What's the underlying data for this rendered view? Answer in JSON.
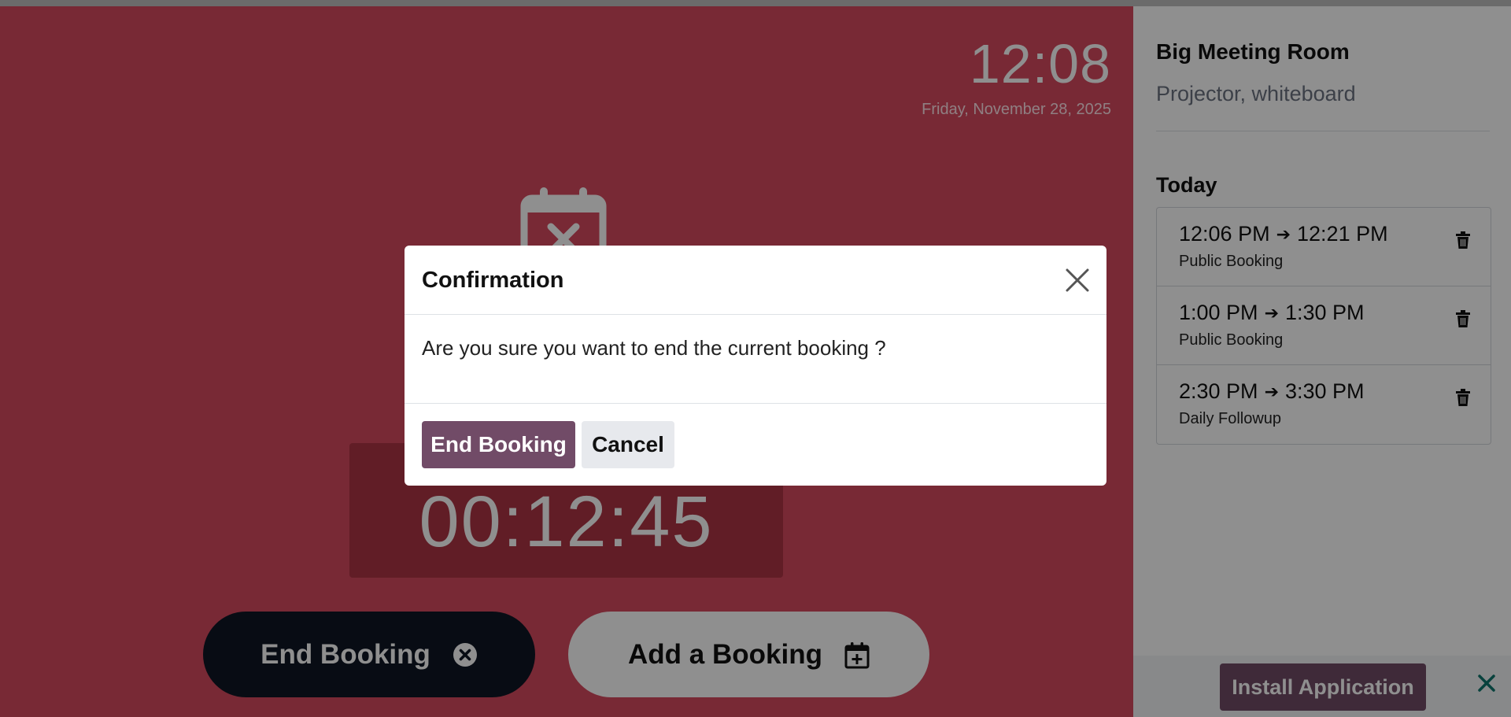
{
  "colors": {
    "main_bg": "#d6495f",
    "timer_bg": "#ad3445",
    "primary": "#714b67",
    "dark_button": "#0f1724"
  },
  "main": {
    "clock_time": "12:08",
    "clock_date": "Friday, November 28, 2025",
    "timer": "00:12:45",
    "end_booking_label": "End Booking",
    "add_booking_label": "Add a Booking"
  },
  "sidebar": {
    "room_name": "Big Meeting Room",
    "room_description": "Projector, whiteboard",
    "section_title": "Today",
    "bookings": [
      {
        "start": "12:06 PM",
        "end": "12:21 PM",
        "name": "Public Booking"
      },
      {
        "start": "1:00 PM",
        "end": "1:30 PM",
        "name": "Public Booking"
      },
      {
        "start": "2:30 PM",
        "end": "3:30 PM",
        "name": "Daily Followup"
      }
    ],
    "install_label": "Install Application"
  },
  "modal": {
    "title": "Confirmation",
    "message": "Are you sure you want to end the current booking ?",
    "confirm_label": "End Booking",
    "cancel_label": "Cancel"
  }
}
